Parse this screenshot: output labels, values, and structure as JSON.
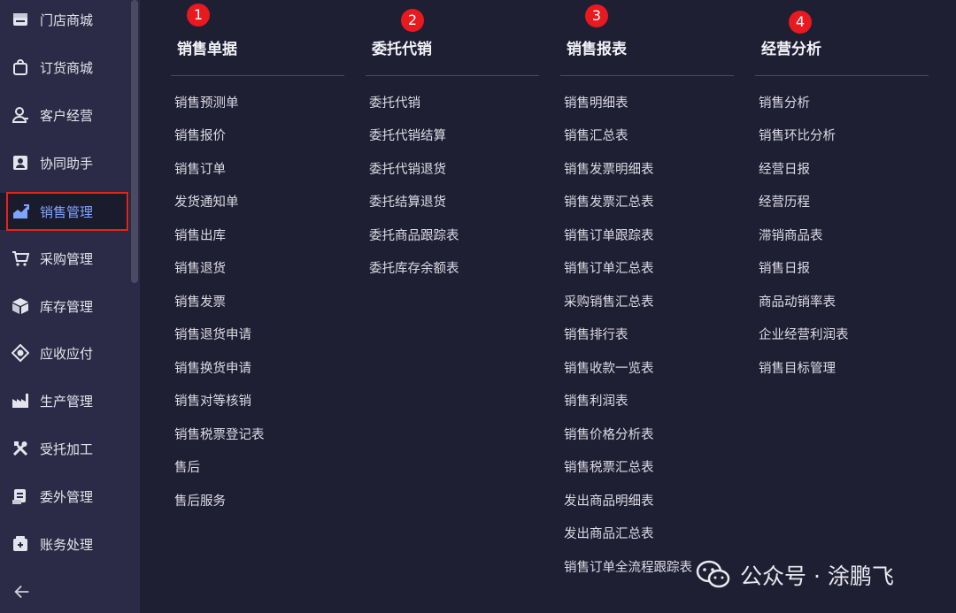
{
  "sidebar": {
    "items": [
      {
        "label": "门店商城",
        "icon": "store-icon"
      },
      {
        "label": "订货商城",
        "icon": "shopping-bag-icon"
      },
      {
        "label": "客户经营",
        "icon": "customer-icon"
      },
      {
        "label": "协同助手",
        "icon": "contact-card-icon"
      },
      {
        "label": "销售管理",
        "icon": "sales-chart-icon",
        "active": true
      },
      {
        "label": "采购管理",
        "icon": "cart-icon"
      },
      {
        "label": "库存管理",
        "icon": "box-icon"
      },
      {
        "label": "应收应付",
        "icon": "finance-icon"
      },
      {
        "label": "生产管理",
        "icon": "factory-icon"
      },
      {
        "label": "受托加工",
        "icon": "tools-icon"
      },
      {
        "label": "委外管理",
        "icon": "outsource-icon"
      },
      {
        "label": "账务处理",
        "icon": "ledger-icon"
      }
    ],
    "back_icon": "arrow-left-icon"
  },
  "columns": [
    {
      "number": "1",
      "title": "销售单据",
      "links": [
        "销售预测单",
        "销售报价",
        "销售订单",
        "发货通知单",
        "销售出库",
        "销售退货",
        "销售发票",
        "销售退货申请",
        "销售换货申请",
        "销售对等核销",
        "销售税票登记表",
        "售后",
        "售后服务"
      ]
    },
    {
      "number": "2",
      "title": "委托代销",
      "links": [
        "委托代销",
        "委托代销结算",
        "委托代销退货",
        "委托结算退货",
        "委托商品跟踪表",
        "委托库存余额表"
      ]
    },
    {
      "number": "3",
      "title": "销售报表",
      "links": [
        "销售明细表",
        "销售汇总表",
        "销售发票明细表",
        "销售发票汇总表",
        "销售订单跟踪表",
        "销售订单汇总表",
        "采购销售汇总表",
        "销售排行表",
        "销售收款一览表",
        "销售利润表",
        "销售价格分析表",
        "销售税票汇总表",
        "发出商品明细表",
        "发出商品汇总表",
        "销售订单全流程跟踪表"
      ]
    },
    {
      "number": "4",
      "title": "经营分析",
      "links": [
        "销售分析",
        "销售环比分析",
        "经营日报",
        "经营历程",
        "滞销商品表",
        "销售日报",
        "商品动销率表",
        "企业经营利润表",
        "销售目标管理"
      ]
    }
  ],
  "watermark": {
    "text": "公众号 · 涂鹏飞",
    "icon": "wechat-icon"
  },
  "colors": {
    "badge": "#e8191f",
    "active_text": "#7ea4ff",
    "highlight_border": "#e5231d"
  }
}
